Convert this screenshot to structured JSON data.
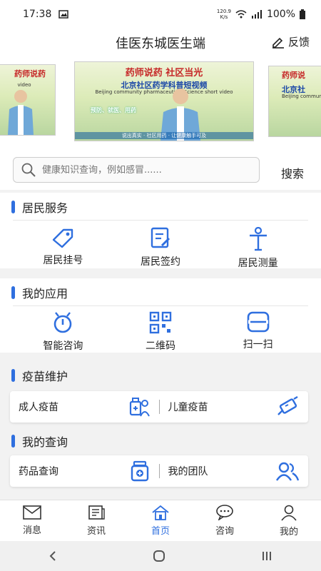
{
  "status": {
    "time": "17:38",
    "net_speed": "120.9",
    "net_unit": "K/s",
    "battery": "100%"
  },
  "header": {
    "title": "佳医东城医生端",
    "feedback": "反馈"
  },
  "banner": {
    "slides": [
      {
        "cap1": "药师说药",
        "cap2": "",
        "cap3": "video"
      },
      {
        "cap1": "药师说药  社区当光",
        "cap2": "北京社区药学科普短视频",
        "cap3": "Beijing community pharmaceutical Science short video",
        "overlay": "预防、就医、用药",
        "sub": "说出真实 · 社区用药 · 让健康触手可及"
      },
      {
        "cap1": "药师说",
        "cap2": "北京社",
        "cap3": "Beijing communit"
      }
    ]
  },
  "search": {
    "placeholder": "健康知识查询，例如感冒......",
    "button": "搜索"
  },
  "resident": {
    "title": "居民服务",
    "items": [
      {
        "label": "居民挂号",
        "icon": "tag-icon"
      },
      {
        "label": "居民签约",
        "icon": "sign-document-icon"
      },
      {
        "label": "居民测量",
        "icon": "body-measure-icon"
      }
    ]
  },
  "apps": {
    "title": "我的应用",
    "items": [
      {
        "label": "智能咨询",
        "icon": "robot-icon"
      },
      {
        "label": "二维码",
        "icon": "qrcode-icon"
      },
      {
        "label": "扫一扫",
        "icon": "scan-icon"
      }
    ]
  },
  "vaccine": {
    "title": "疫苗维护",
    "left": "成人疫苗",
    "right": "儿童疫苗"
  },
  "query": {
    "title": "我的查询",
    "left": "药品查询",
    "right": "我的团队"
  },
  "tabs": [
    {
      "label": "消息",
      "icon": "mail-icon"
    },
    {
      "label": "资讯",
      "icon": "news-icon"
    },
    {
      "label": "首页",
      "icon": "home-icon"
    },
    {
      "label": "咨询",
      "icon": "chat-icon"
    },
    {
      "label": "我的",
      "icon": "user-icon"
    }
  ],
  "colors": {
    "accent": "#2f6fdf",
    "text": "#222222"
  }
}
